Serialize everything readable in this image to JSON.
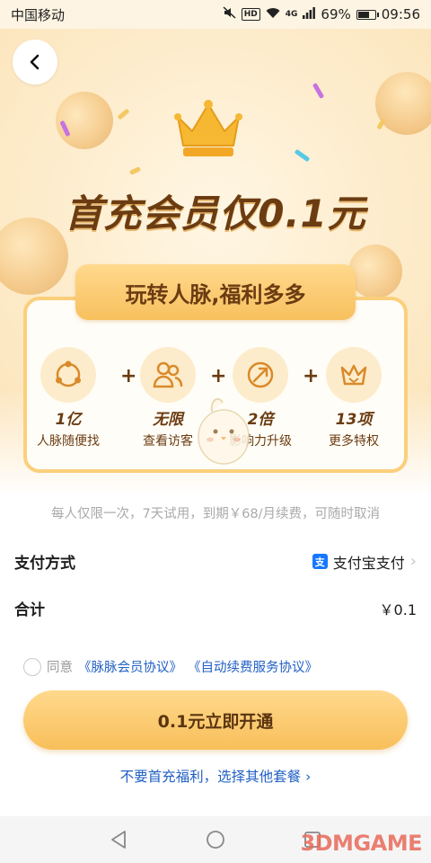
{
  "status_bar": {
    "carrier": "中国移动",
    "network": "4G",
    "battery": "69%",
    "battery_level": 0.69,
    "time": "09:56",
    "icons": [
      "mute-icon",
      "hd-icon",
      "wifi-icon",
      "signal-icon",
      "battery-icon"
    ]
  },
  "hero": {
    "title": "首充会员仅0.1元",
    "banner": "玩转人脉,福利多多"
  },
  "benefits": [
    {
      "value": "1亿",
      "label": "人脉随便找",
      "icon": "network-icon"
    },
    {
      "value": "无限",
      "label": "查看访客",
      "icon": "visitors-icon"
    },
    {
      "value": "2倍",
      "label": "影响力升级",
      "icon": "influence-icon"
    },
    {
      "value": "13项",
      "label": "更多特权",
      "icon": "crown-icon"
    }
  ],
  "notice": "每人仅限一次，7天试用，到期￥68/月续费，可随时取消",
  "payment": {
    "label": "支付方式",
    "method": "支付宝支付",
    "method_icon": "alipay-icon"
  },
  "total": {
    "label": "合计",
    "value": "￥0.1"
  },
  "agreement": {
    "prefix": "同意",
    "link1": "《脉脉会员协议》",
    "link2": "《自动续费服务协议》"
  },
  "cta_label": "0.1元立即开通",
  "other_plans": "不要首充福利，选择其他套餐",
  "watermark": "3DMGAME",
  "colors": {
    "accent": "#f8c05e",
    "brown": "#6b3c12",
    "link": "#2260c4"
  }
}
